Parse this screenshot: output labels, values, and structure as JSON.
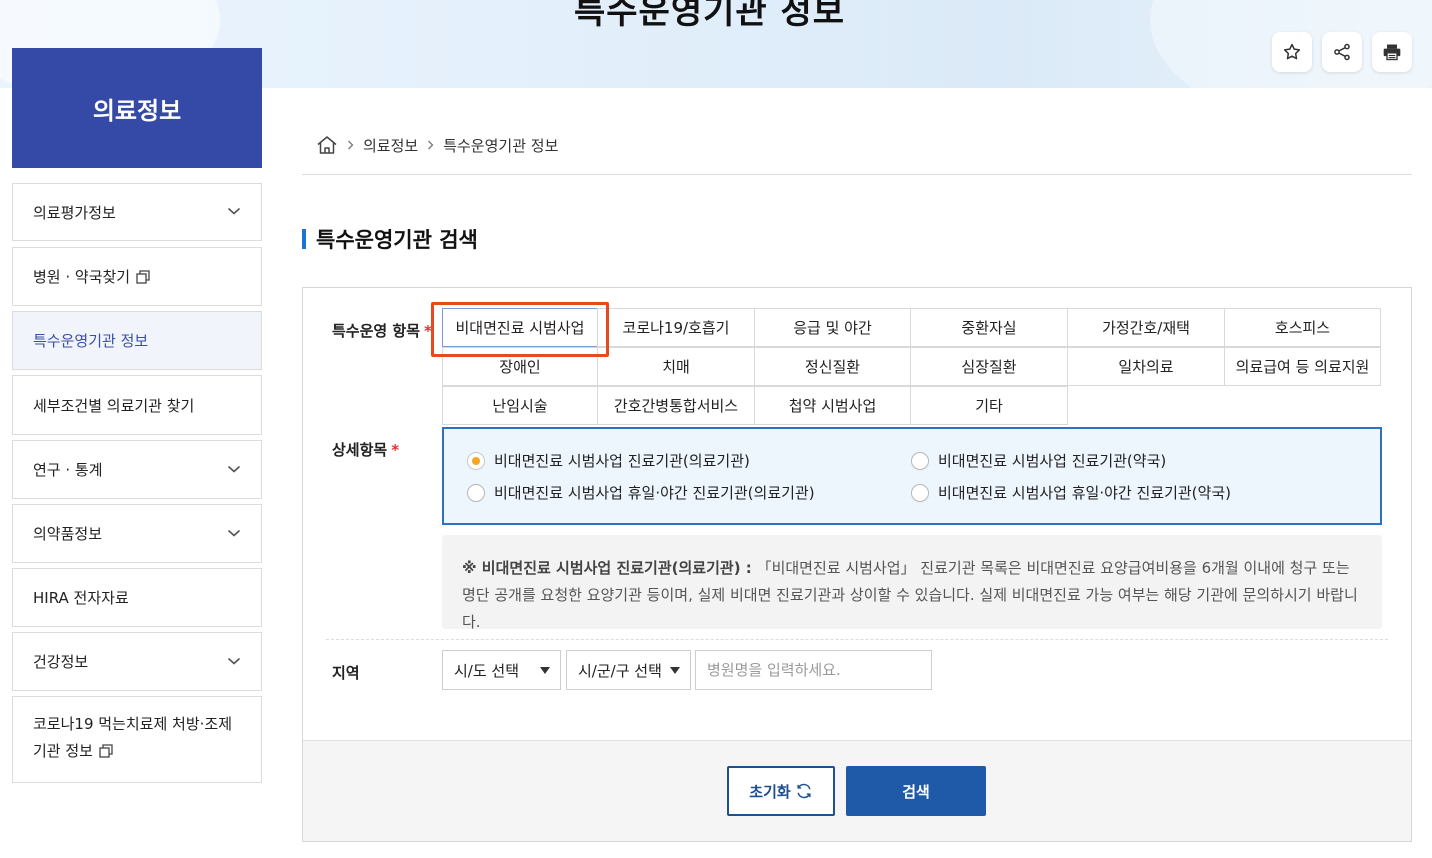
{
  "banner": {
    "title": "특수운영기관 정보"
  },
  "toolbar": {
    "favorite_icon": "star-icon",
    "share_icon": "share-icon",
    "print_icon": "print-icon"
  },
  "sidebar": {
    "title": "의료정보",
    "items": [
      {
        "label": "의료평가정보",
        "expandable": true
      },
      {
        "label": "병원 · 약국찾기",
        "external": true
      },
      {
        "label": "특수운영기관 정보",
        "active": true
      },
      {
        "label": "세부조건별 의료기관 찾기"
      },
      {
        "label": "연구 · 통계",
        "expandable": true
      },
      {
        "label": "의약품정보",
        "expandable": true
      },
      {
        "label": "HIRA 전자자료"
      },
      {
        "label": "건강정보",
        "expandable": true
      },
      {
        "label_line1": "코로나19 먹는치료제 처방·조제",
        "label_line2": "기관 정보",
        "external": true
      }
    ]
  },
  "breadcrumb": {
    "home_icon": "home-icon",
    "level1": "의료정보",
    "level2": "특수운영기관 정보"
  },
  "section": {
    "title": "특수운영기관 검색"
  },
  "form": {
    "category_label": "특수운영 항목",
    "required_mark": "*",
    "categories": [
      "비대면진료 시범사업",
      "코로나19/호흡기",
      "응급 및 야간",
      "중환자실",
      "가정간호/재택",
      "호스피스",
      "장애인",
      "치매",
      "정신질환",
      "심장질환",
      "일차의료",
      "의료급여 등 의료지원",
      "난임시술",
      "간호간병통합서비스",
      "첩약 시범사업",
      "기타"
    ],
    "selected_category": "비대면진료 시범사업",
    "detail_label": "상세항목",
    "detail_options": [
      {
        "label": "비대면진료 시범사업 진료기관(의료기관)",
        "checked": true
      },
      {
        "label": "비대면진료 시범사업 진료기관(약국)",
        "checked": false
      },
      {
        "label": "비대면진료 시범사업 휴일·야간 진료기관(의료기관)",
        "checked": false
      },
      {
        "label": "비대면진료 시범사업 휴일·야간 진료기관(약국)",
        "checked": false
      }
    ],
    "notice_title": "※ 비대면진료 시범사업 진료기관(의료기관) :",
    "notice_text": " 「비대면진료 시범사업」 진료기관 목록은 비대면진료 요양급여비용을 6개월 이내에 청구 또는 명단 공개를 요청한 요양기관 등이며, 실제 비대면 진료기관과 상이할 수 있습니다. 실제 비대면진료 가능 여부는 해당 기관에 문의하시기 바랍니다.",
    "region_label": "지역",
    "sido_select": "시/도 선택",
    "sigungu_select": "시/군/구 선택",
    "hospital_placeholder": "병원명을 입력하세요.",
    "reset_label": "초기화",
    "search_label": "검색"
  },
  "colors": {
    "sidebar_head": "#3549a6",
    "accent": "#1a74d6",
    "highlight": "#e8491d",
    "primary_button": "#1e5aa8"
  }
}
